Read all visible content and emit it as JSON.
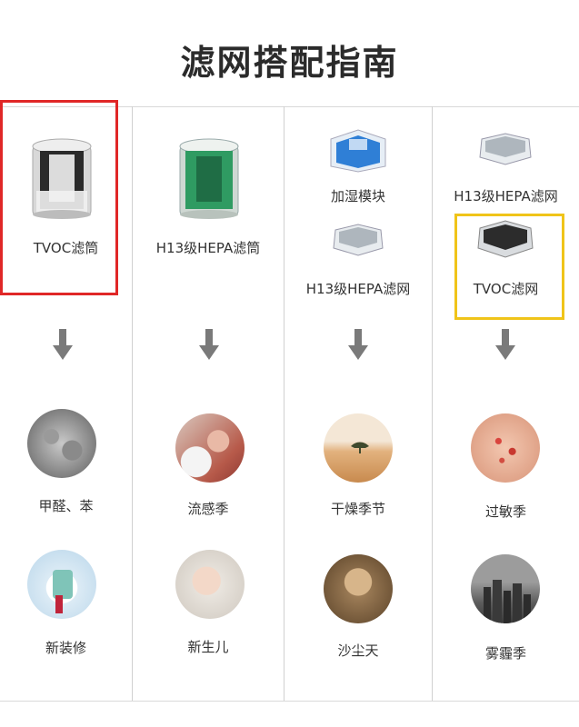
{
  "title": "滤网搭配指南",
  "columns": [
    {
      "filters": [
        "TVOC滤筒"
      ],
      "scenes": [
        "甲醛、苯",
        "新装修"
      ]
    },
    {
      "filters": [
        "H13级HEPA滤筒"
      ],
      "scenes": [
        "流感季",
        "新生儿"
      ]
    },
    {
      "filters": [
        "加湿模块",
        "H13级HEPA滤网"
      ],
      "scenes": [
        "干燥季节",
        "沙尘天"
      ]
    },
    {
      "filters": [
        "H13级HEPA滤网",
        "TVOC滤网"
      ],
      "scenes": [
        "过敏季",
        "雾霾季"
      ]
    }
  ],
  "colors": {
    "highlight_red": "#e02727",
    "highlight_yellow": "#f0c419",
    "arrow": "#7a7a7a"
  }
}
